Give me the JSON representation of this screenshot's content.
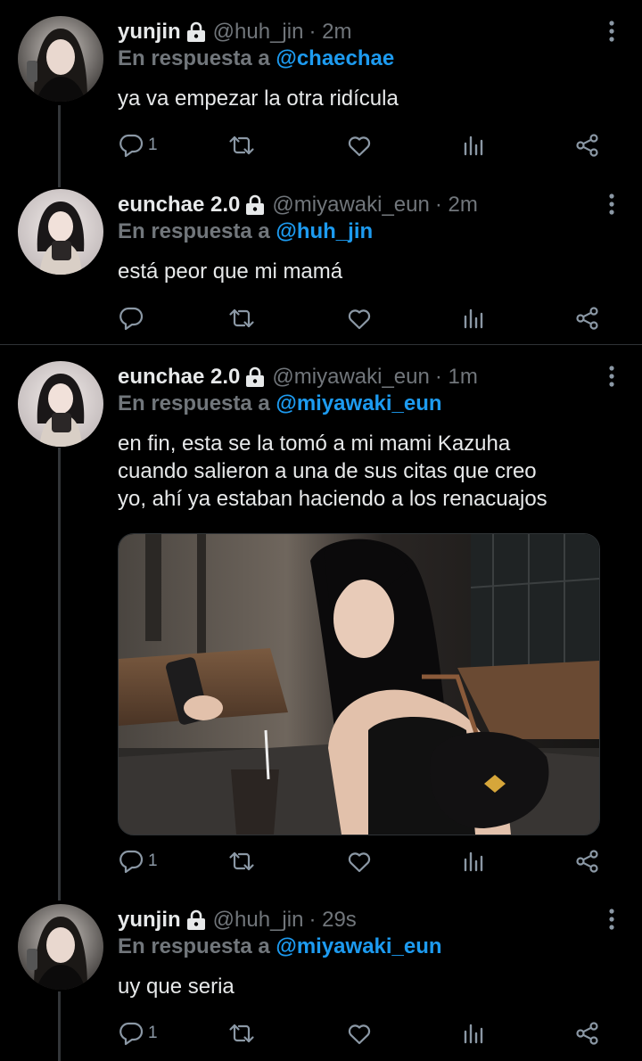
{
  "tweets": [
    {
      "name": "yunjin",
      "handle": "@huh_jin",
      "time": "· 2m",
      "reply_prefix": "En respuesta a ",
      "reply_to": "@chaechae",
      "text_lines": [
        "ya va empezar la otra ridícula"
      ],
      "reply_count": "1"
    },
    {
      "name": "eunchae 2.0",
      "handle": "@miyawaki_eun",
      "time": "· 2m",
      "reply_prefix": "En respuesta a ",
      "reply_to": "@huh_jin",
      "text_lines": [
        "está peor que mi mamá"
      ],
      "reply_count": ""
    },
    {
      "name": "eunchae 2.0",
      "handle": "@miyawaki_eun",
      "time": "· 1m",
      "reply_prefix": "En respuesta a ",
      "reply_to": "@miyawaki_eun",
      "text_lines": [
        "en fin, esta se la tomó a mi mami Kazuha",
        "cuando salieron a una de sus citas que creo",
        "yo, ahí ya estaban haciendo a los renacuajos"
      ],
      "reply_count": "1"
    },
    {
      "name": "yunjin",
      "handle": "@huh_jin",
      "time": "· 29s",
      "reply_prefix": "En respuesta a ",
      "reply_to": "@miyawaki_eun",
      "text_lines": [
        "uy que seria"
      ],
      "reply_count": "1"
    }
  ],
  "colors": {
    "background": "#000000",
    "text": "#e7e9ea",
    "secondary": "#71767b",
    "accent": "#1d9bf0",
    "thread_line": "#333639"
  },
  "icons": [
    "lock-icon",
    "more-icon",
    "reply-icon",
    "retweet-icon",
    "like-icon",
    "views-icon",
    "share-icon"
  ]
}
